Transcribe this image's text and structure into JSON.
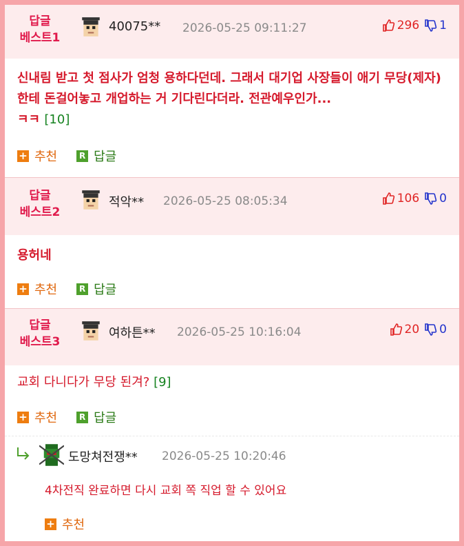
{
  "comments": [
    {
      "best_label_1": "답글",
      "best_label_2": "베스트1",
      "nick": "40075**",
      "date": "2026-05-25 09:11:27",
      "up": "296",
      "down": "1",
      "text": "신내림 받고 첫 점사가 엄청 용하다던데. 그래서 대기업 사장들이 애기 무당(제자)한테 돈걸어놓고 개업하는 거 기다린다더라. 전관예우인가...",
      "text_tail": "ㅋㅋ",
      "reply_count": "[10]"
    },
    {
      "best_label_1": "답글",
      "best_label_2": "베스트2",
      "nick": "적악**",
      "date": "2026-05-25 08:05:34",
      "up": "106",
      "down": "0",
      "text": "용허네"
    },
    {
      "best_label_1": "답글",
      "best_label_2": "베스트3",
      "nick": "여하튼**",
      "date": "2026-05-25 10:16:04",
      "up": "20",
      "down": "0",
      "text": "교회 다니다가 무당 된겨?",
      "reply_count": "[9]"
    }
  ],
  "reply": {
    "nick": "도망쳐전쟁**",
    "date": "2026-05-25 10:20:46",
    "text": "4차전직 완료하면 다시 교회 쪽 직업 할 수 있어요"
  },
  "actions": {
    "recommend": "추천",
    "reply": "답글",
    "plus_glyph": "+",
    "r_glyph": "R"
  },
  "colors": {
    "frame": "#f6a5a9",
    "header_bg": "#fdeced",
    "best_label": "#e0194b",
    "body_text": "#d5192b",
    "reply_count": "#15821f",
    "thumb_up": "#e02424",
    "thumb_down": "#2233cc"
  }
}
